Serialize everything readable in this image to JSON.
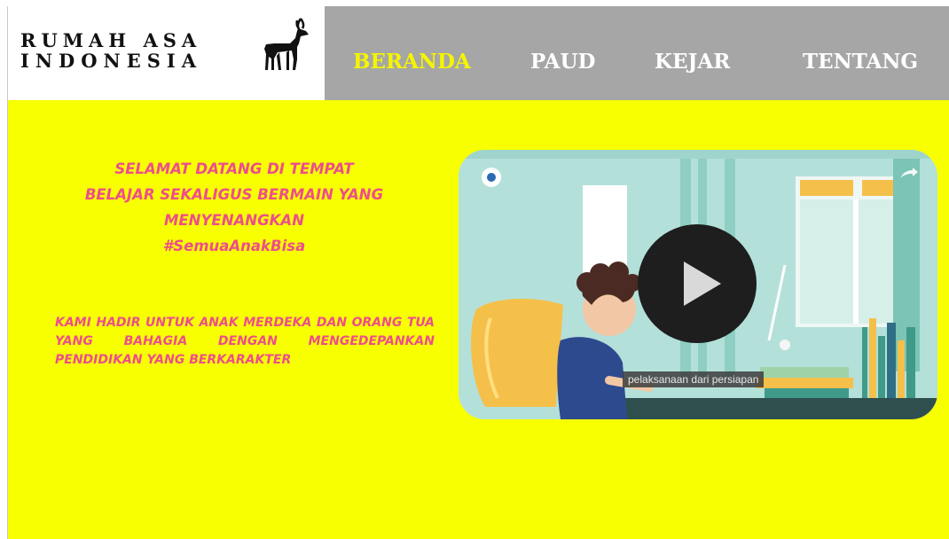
{
  "brand": {
    "line1": "RUMAH ASA",
    "line2": "INDONESIA",
    "logo_icon": "deer-icon"
  },
  "nav": {
    "items": [
      {
        "label": "BERANDA",
        "active": true
      },
      {
        "label": "PAUD",
        "active": false
      },
      {
        "label": "KEJAR",
        "active": false
      },
      {
        "label": "TENTANG",
        "active": false
      }
    ]
  },
  "main": {
    "welcome_lines": [
      "SELAMAT DATANG DI TEMPAT",
      "BELAJAR SEKALIGUS BERMAIN YANG",
      "MENYENANGKAN",
      "#SemuaAnakBisa"
    ],
    "mission": "KAMI HADIR UNTUK ANAK MERDEKA DAN ORANG TUA YANG BAHAGIA DENGAN MENGEDEPANKAN PENDIDIKAN YANG BERKARAKTER"
  },
  "video": {
    "caption": "pelaksanaan dari persiapan",
    "play_icon": "play-icon"
  },
  "colors": {
    "main_bg": "#f7ff00",
    "nav_bg": "#a6a6a6",
    "nav_active": "#f5f500",
    "text_pink": "#ee4d8c"
  }
}
